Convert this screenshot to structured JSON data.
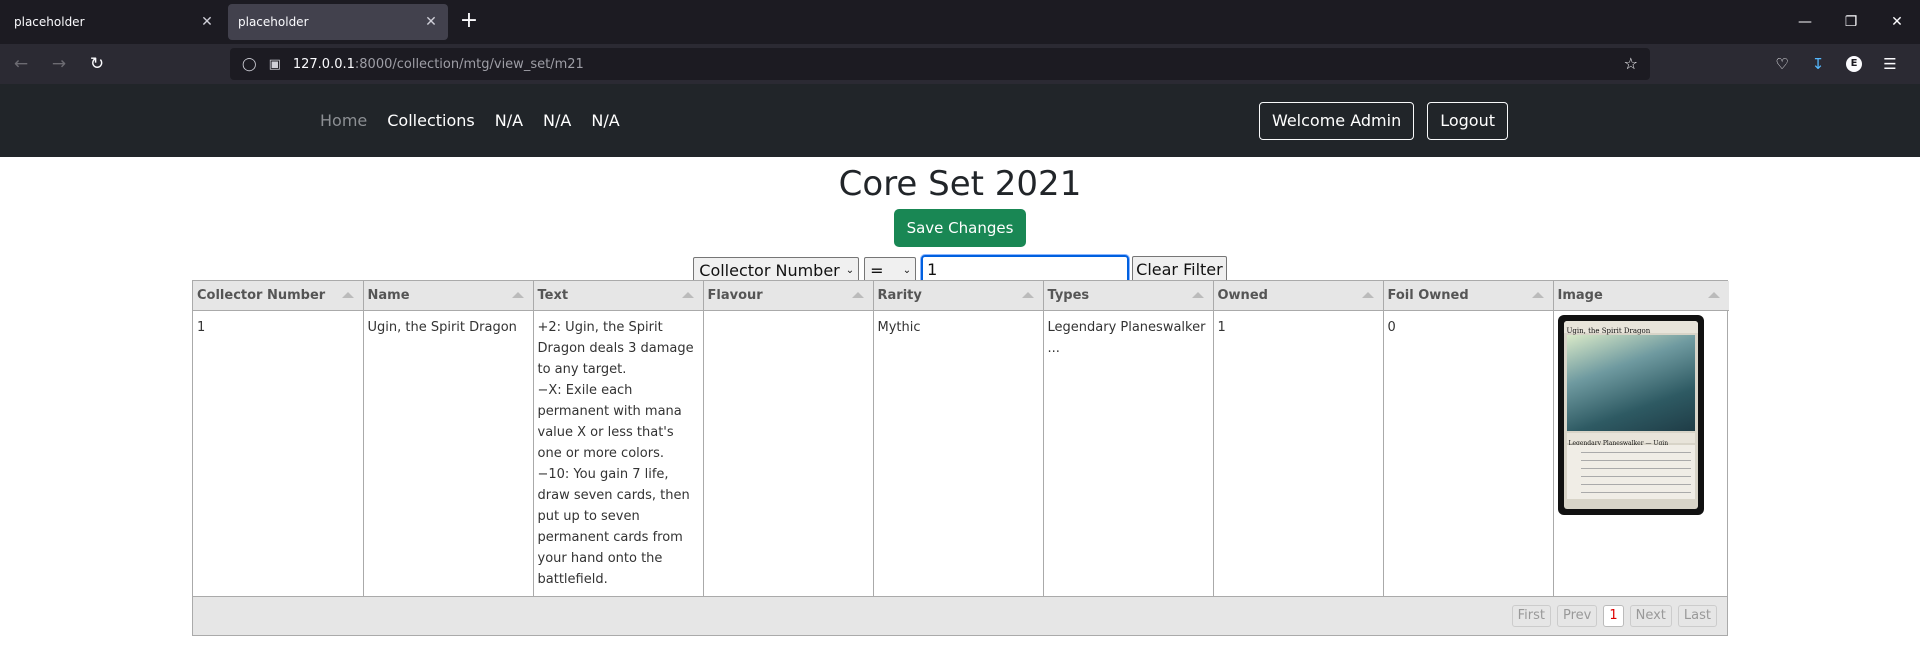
{
  "browser": {
    "tabs": [
      {
        "label": "placeholder"
      },
      {
        "label": "placeholder"
      }
    ],
    "url_host": "127.0.0.1",
    "url_path": ":8000/collection/mtg/view_set/m21"
  },
  "sitenav": {
    "links": [
      "Home",
      "Collections",
      "N/A",
      "N/A",
      "N/A"
    ],
    "welcome": "Welcome Admin",
    "logout": "Logout"
  },
  "page": {
    "title": "Core Set 2021",
    "save_label": "Save Changes"
  },
  "filter": {
    "field": "Collector Number",
    "operator": "=",
    "value": "1",
    "clear_label": "Clear Filter"
  },
  "table": {
    "headers": [
      "Collector Number",
      "Name",
      "Text",
      "Flavour",
      "Rarity",
      "Types",
      "Owned",
      "Foil Owned",
      "Image"
    ],
    "rows": [
      {
        "collector_number": "1",
        "name": "Ugin, the Spirit Dragon",
        "text": "+2: Ugin, the Spirit Dragon deals 3 damage to any target.\n−X: Exile each permanent with mana value X or less that's one or more colors.\n−10: You gain 7 life, draw seven cards, then put up to seven permanent cards from your hand onto the battlefield.",
        "flavour": "",
        "rarity": "Mythic",
        "types": "Legendary Planeswalker ...",
        "owned": "1",
        "foil_owned": "0",
        "image_card_title": "Ugin, the Spirit Dragon",
        "image_card_type": "Legendary Planeswalker — Ugin"
      }
    ]
  },
  "pagination": {
    "first": "First",
    "prev": "Prev",
    "current": "1",
    "next": "Next",
    "last": "Last"
  }
}
